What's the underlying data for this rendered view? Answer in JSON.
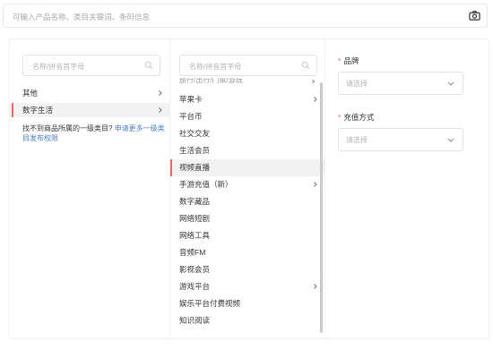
{
  "search": {
    "placeholder": "可输入产品名称、类目关键词、条码信息"
  },
  "left_column": {
    "search_placeholder": "名称/拼音首字母",
    "items": [
      {
        "label": "其他"
      },
      {
        "label": "数字生活"
      }
    ],
    "not_found_text": "找不到商品所属的一级类目?",
    "not_found_link": "申请更多一级类目发布权限"
  },
  "middle_column": {
    "search_placeholder": "名称/拼音首字母",
    "cut_off_label": "旅行/出行/门票/游玩",
    "items": [
      {
        "label": "苹果卡"
      },
      {
        "label": "平台币"
      },
      {
        "label": "社交交友"
      },
      {
        "label": "生活会员"
      },
      {
        "label": "视频直播"
      },
      {
        "label": "手游充值（新）"
      },
      {
        "label": "数字藏品"
      },
      {
        "label": "网络短剧"
      },
      {
        "label": "网络工具"
      },
      {
        "label": "音频FM"
      },
      {
        "label": "影视会员"
      },
      {
        "label": "游戏平台"
      },
      {
        "label": "娱乐平台付费视频"
      },
      {
        "label": "知识阅读"
      }
    ]
  },
  "right_column": {
    "brand": {
      "label": "品牌",
      "placeholder": "请选择"
    },
    "recharge": {
      "label": "充值方式",
      "placeholder": "请选择"
    }
  },
  "colors": {
    "accent": "#e36b6b",
    "link": "#4a7fbf",
    "border": "#e9e9e9"
  },
  "icons": {
    "camera": "camera-icon",
    "search": "search-icon",
    "chevron": "chevron-right-icon",
    "dropdown": "chevron-down-icon"
  }
}
